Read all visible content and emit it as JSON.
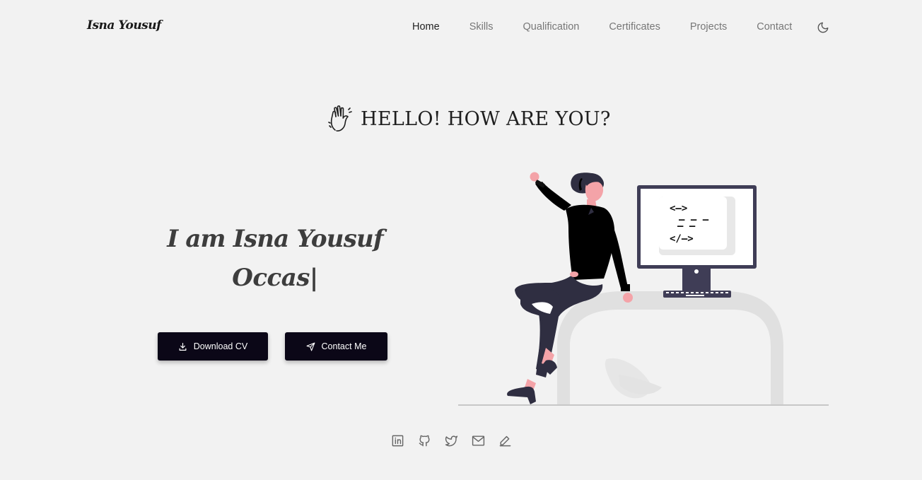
{
  "brand": {
    "logo": "Isna Yousuf"
  },
  "nav": {
    "items": [
      {
        "label": "Home",
        "active": true
      },
      {
        "label": "Skills",
        "active": false
      },
      {
        "label": "Qualification",
        "active": false
      },
      {
        "label": "Certificates",
        "active": false
      },
      {
        "label": "Projects",
        "active": false
      },
      {
        "label": "Contact",
        "active": false
      }
    ],
    "theme_icon": "moon-icon"
  },
  "hero": {
    "greeting": "HELLO! HOW ARE YOU?",
    "greeting_icon": "waving-hand-icon",
    "intro_name": "I am Isna Yousuf",
    "intro_typed": "Occas|",
    "buttons": {
      "download_cv": {
        "label": "Download CV",
        "icon": "download-icon"
      },
      "contact_me": {
        "label": "Contact Me",
        "icon": "send-icon"
      }
    },
    "illustration": "woman-at-computer-illustration",
    "code_display": [
      "<—>",
      "— — —",
      "— —",
      "</—>"
    ]
  },
  "social": {
    "icons": [
      "linkedin-icon",
      "github-icon",
      "twitter-icon",
      "mail-icon",
      "pen-icon"
    ]
  },
  "colors": {
    "background": "#f2f2f2",
    "button": "#0b0717",
    "text_dark": "#222222",
    "text_muted": "#777777",
    "illustration_dark": "#2f2e41",
    "skin": "#f4a3a8"
  }
}
